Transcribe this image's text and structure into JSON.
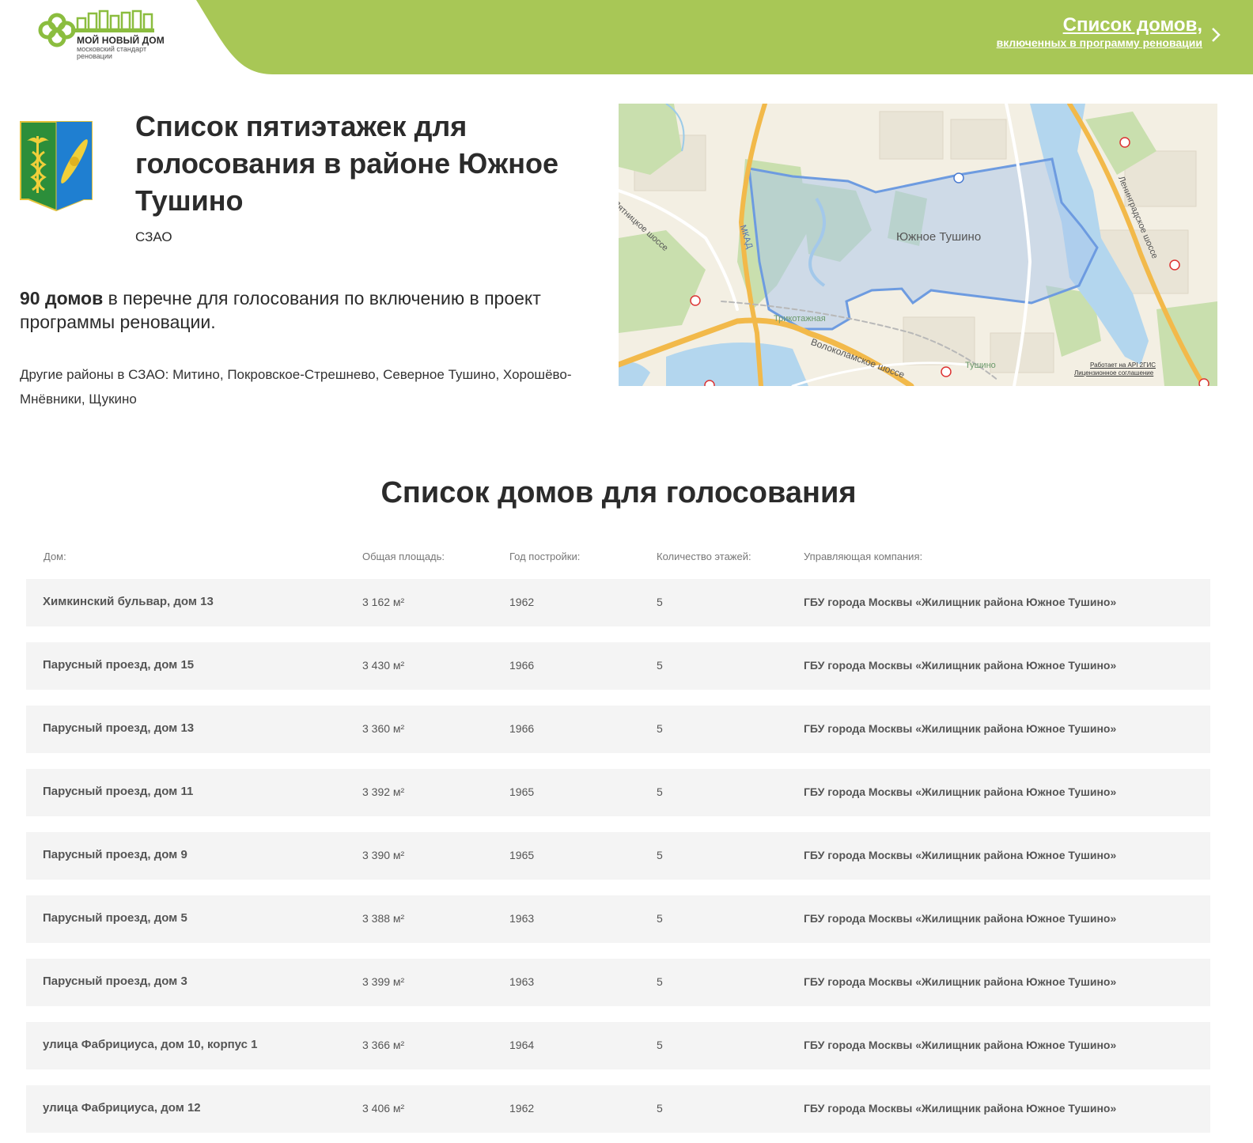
{
  "header": {
    "logo_title": "МОЙ НОВЫЙ ДОМ",
    "logo_subtitle": "московский стандарт реновации",
    "link_main": "Список домов,",
    "link_sub": "включенных в программу реновации",
    "brand_color": "#a8c756"
  },
  "intro": {
    "title": "Список пятиэтажек для голосования в районе Южное Тушино",
    "okrug": "СЗАО",
    "summary_count": "90 домов",
    "summary_text": " в перечне для голосования по включению в проект программы реновации.",
    "others": "Другие районы в СЗАО: Митино, Покровское-Стрешнево, Северное Тушино, Хорошёво-Мнёвники, Щукино"
  },
  "map": {
    "district_label": "Южное Тушино",
    "labels": {
      "pyatnitskoe": "Пятницкое шоссе",
      "mkad": "МКАД",
      "trikotazhnaya": "Трикотажная",
      "tushino": "Тушино",
      "volokolamskoe": "Волоколамское шоссе",
      "leningradskoe": "Ленинградское шоссе",
      "attribution_1": "Работает на API 2ГИС",
      "attribution_2": "Лицензионное соглашение"
    }
  },
  "table": {
    "title": "Список домов для голосования",
    "columns": [
      "Дом:",
      "Общая площадь:",
      "Год постройки:",
      "Количество этажей:",
      "Управляющая компания:"
    ],
    "rows": [
      {
        "address": "Химкинский бульвар, дом 13",
        "area": "3 162 м²",
        "year": "1962",
        "floors": "5",
        "company": "ГБУ города Москвы «Жилищник района Южное Тушино»"
      },
      {
        "address": "Парусный проезд, дом 15",
        "area": "3 430 м²",
        "year": "1966",
        "floors": "5",
        "company": "ГБУ города Москвы «Жилищник района Южное Тушино»"
      },
      {
        "address": "Парусный проезд, дом 13",
        "area": "3 360 м²",
        "year": "1966",
        "floors": "5",
        "company": "ГБУ города Москвы «Жилищник района Южное Тушино»"
      },
      {
        "address": "Парусный проезд, дом 11",
        "area": "3 392 м²",
        "year": "1965",
        "floors": "5",
        "company": "ГБУ города Москвы «Жилищник района Южное Тушино»"
      },
      {
        "address": "Парусный проезд, дом 9",
        "area": "3 390 м²",
        "year": "1965",
        "floors": "5",
        "company": "ГБУ города Москвы «Жилищник района Южное Тушино»"
      },
      {
        "address": "Парусный проезд, дом 5",
        "area": "3 388 м²",
        "year": "1963",
        "floors": "5",
        "company": "ГБУ города Москвы «Жилищник района Южное Тушино»"
      },
      {
        "address": "Парусный проезд, дом 3",
        "area": "3 399 м²",
        "year": "1963",
        "floors": "5",
        "company": "ГБУ города Москвы «Жилищник района Южное Тушино»"
      },
      {
        "address": "улица Фабрициуса, дом 10, корпус 1",
        "area": "3 366 м²",
        "year": "1964",
        "floors": "5",
        "company": "ГБУ города Москвы «Жилищник района Южное Тушино»"
      },
      {
        "address": "улица Фабрициуса, дом 12",
        "area": "3 406 м²",
        "year": "1962",
        "floors": "5",
        "company": "ГБУ города Москвы «Жилищник района Южное Тушино»"
      }
    ]
  }
}
